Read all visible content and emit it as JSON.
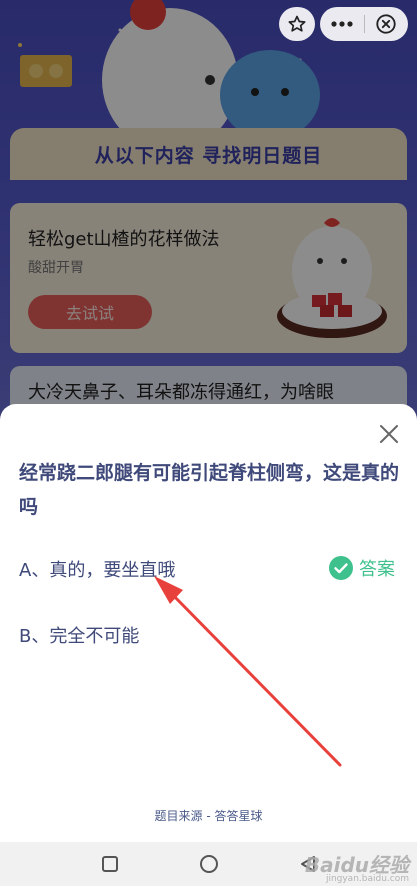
{
  "background": {
    "banner_title": "从以下内容 寻找明日题目",
    "card1": {
      "title": "轻松get山楂的花样做法",
      "subtitle": "酸甜开胃",
      "button": "去试试"
    },
    "card2": {
      "text": "大冷天鼻子、耳朵都冻得通红，为啥眼"
    }
  },
  "top_bar": {
    "icons": [
      "star-icon",
      "more-icon",
      "close-circle-icon"
    ]
  },
  "sheet": {
    "question": "经常跷二郎腿有可能引起脊柱侧弯，这是真的吗",
    "options": [
      {
        "label": "A、真的，要坐直哦",
        "is_answer": true
      },
      {
        "label": "B、完全不可能",
        "is_answer": false
      }
    ],
    "answer_label": "答案",
    "source": "题目来源 - 答答星球"
  },
  "colors": {
    "accent_green": "#3ec18c",
    "question_text": "#3f4a7a",
    "arrow_red": "#e8413c"
  },
  "watermark": {
    "brand": "Baidu经验",
    "sub": "jingyan.baidu.com"
  }
}
